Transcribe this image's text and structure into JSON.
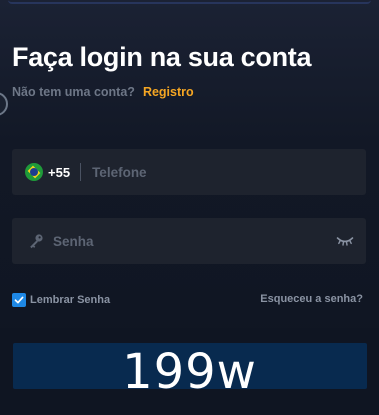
{
  "header": {
    "title": "Faça login na sua conta",
    "no_account_text": "Não tem uma conta?",
    "register_link": "Registro"
  },
  "phone": {
    "flag_icon": "brazil-flag-icon",
    "dial_code": "+55",
    "placeholder": "Telefone",
    "value": ""
  },
  "password": {
    "key_icon": "key-icon",
    "placeholder": "Senha",
    "value": "",
    "visibility_icon": "eye-closed-icon"
  },
  "options": {
    "remember_label": "Lembrar Senha",
    "remember_checked": true,
    "forgot_link": "Esqueceu a senha?"
  },
  "overlay_text": "199w",
  "colors": {
    "accent": "#f5a623",
    "checkbox": "#1e88e5",
    "button": "#082a4f",
    "background": "#141a26",
    "field": "#1e232e"
  }
}
